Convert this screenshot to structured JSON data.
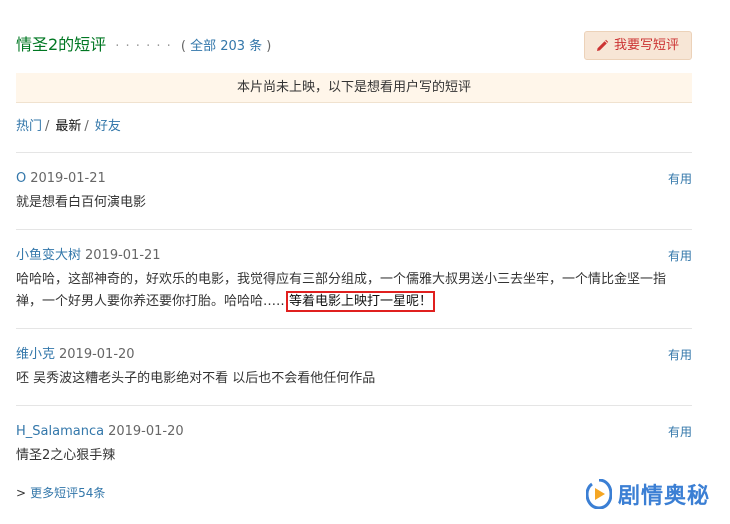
{
  "header": {
    "title": "情圣2的短评",
    "dots": "· · · · · ·",
    "count_prefix": "( ",
    "count_link": "全部 203 条",
    "count_suffix": " )",
    "write_button": "我要写短评"
  },
  "notice": "本片尚未上映，以下是想看用户写的短评",
  "tabs": [
    {
      "label": "热门",
      "active": false
    },
    {
      "label": "最新",
      "active": true
    },
    {
      "label": "好友",
      "active": false
    }
  ],
  "tab_separator": "/",
  "useful_label": "有用",
  "comments": [
    {
      "user": "O",
      "date": "2019-01-21",
      "text": "就是想看白百何演电影"
    },
    {
      "user": "小鱼变大树",
      "date": "2019-01-21",
      "text_line1": "哈哈哈，这部神奇的，好欢乐的电影，我觉得应有三部分组成，一个儒雅大叔男送小三去坐牢，一个情比金坚一指",
      "text_line2a": "禅，一个好男人要你养还要你打胎。哈哈哈……",
      "text_line2b": "等着电影上映打一星呢！"
    },
    {
      "user": "维小克",
      "date": "2019-01-20",
      "text": "呸 吴秀波这糟老头子的电影绝对不看 以后也不会看他任何作品"
    },
    {
      "user": "H_Salamanca",
      "date": "2019-01-20",
      "text": "情圣2之心狠手辣"
    }
  ],
  "more": {
    "arrow": ">",
    "label": "更多短评54条"
  },
  "watermark": {
    "text": "剧情奥秘"
  },
  "colors": {
    "title_green": "#007722",
    "link_blue": "#37a",
    "highlight_red": "#e0201f",
    "notice_bg": "#fff6ea"
  }
}
